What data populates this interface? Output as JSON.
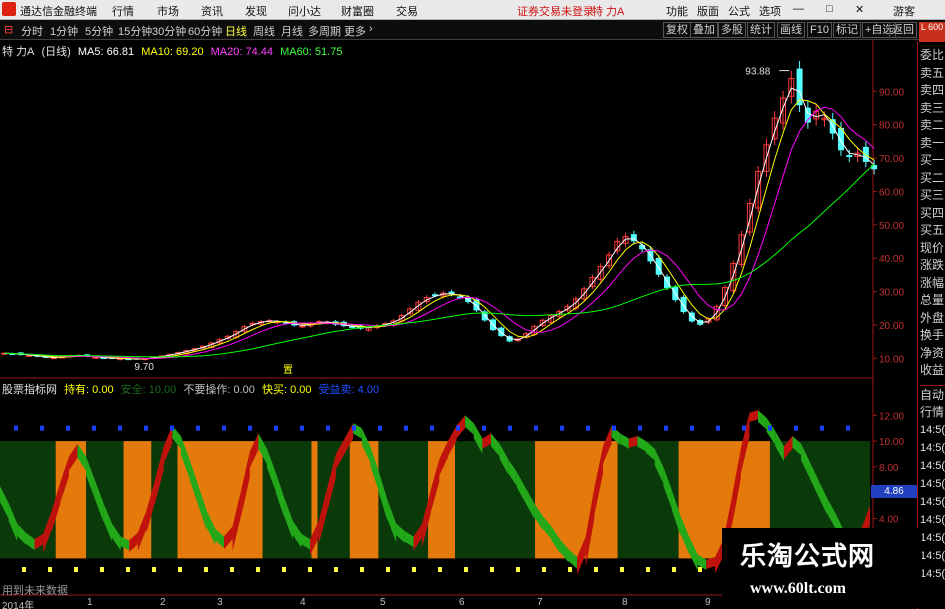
{
  "menubar": {
    "app_title": "通达信金融终端",
    "items": [
      "行情",
      "市场",
      "资讯",
      "发现",
      "问小达",
      "财富圈",
      "交易"
    ],
    "notice": "证券交易未登录",
    "stock_name": "特 力A",
    "right_items": [
      "功能",
      "版面",
      "公式",
      "选项"
    ],
    "user": "游客"
  },
  "toolbar": {
    "periods": [
      "分时",
      "1分钟",
      "5分钟",
      "15分钟",
      "30分钟",
      "60分钟",
      "日线",
      "周线",
      "月线",
      "多周期",
      "更多"
    ],
    "active_period": "日线",
    "right_buttons": [
      "复权",
      "叠加",
      "多股",
      "统计",
      "画线",
      "F10",
      "标记",
      "+自选",
      "返回"
    ]
  },
  "main_chart": {
    "name": "特 力A",
    "period": "(日线)",
    "ma5": "MA5: 66.81",
    "ma10": "MA10: 69.20",
    "ma20": "MA20: 74.44",
    "ma60": "MA60: 51.75",
    "high_label": "93.88",
    "low_label": "9.70",
    "marker_label": "置",
    "colors": {
      "ma5": "#ffffff",
      "ma10": "#ffff00",
      "ma20": "#ff00ff",
      "ma60": "#00ff00",
      "up": "#ff3c3c",
      "down": "#54ffff"
    }
  },
  "indicator": {
    "name": "股票指标网",
    "hold": "持有: 0.00",
    "safe": "安全: 10.00",
    "noop": "不要操作: 0.00",
    "buy": "快买: 0.00",
    "sell_label": "受益卖: 4.00",
    "value_badge": "4.86"
  },
  "chart_data": [
    {
      "type": "candlestick",
      "title": "特 力A (日线)",
      "ylim": [
        5,
        100
      ],
      "y_ticks": [
        "90.00",
        "80.00",
        "70.00",
        "60.00",
        "50.00",
        "40.00",
        "30.00",
        "20.00",
        "10.00"
      ],
      "x_ticks": [
        "2014年",
        "1",
        "2",
        "3",
        "4",
        "5",
        "6",
        "7",
        "8",
        "9"
      ],
      "ma_last": {
        "MA5": 66.81,
        "MA10": 69.2,
        "MA20": 74.44,
        "MA60": 51.75
      },
      "close_path": [
        11.5,
        11.4,
        11.1,
        10.9,
        10.6,
        10.3,
        10.2,
        10.4,
        10.8,
        10.9,
        10.6,
        10.3,
        10.1,
        10.0,
        9.9,
        9.8,
        9.8,
        9.9,
        10.3,
        10.7,
        11.2,
        11.7,
        12.3,
        12.9,
        13.6,
        14.6,
        15.6,
        16.6,
        18.0,
        19.5,
        20.5,
        21.0,
        21.3,
        21.0,
        20.6,
        20.0,
        19.7,
        20.4,
        21.0,
        20.8,
        20.2,
        19.8,
        19.5,
        19.0,
        19.3,
        19.8,
        20.4,
        21.2,
        22.8,
        24.8,
        26.8,
        28.2,
        29.0,
        29.5,
        29.3,
        28.4,
        27.0,
        24.5,
        21.5,
        18.6,
        16.8,
        15.2,
        15.8,
        17.4,
        19.6,
        21.4,
        22.8,
        24.0,
        25.6,
        27.8,
        30.8,
        34.2,
        37.5,
        41.0,
        45.0,
        46.5,
        45.2,
        42.8,
        39.2,
        35.2,
        31.2,
        27.6,
        24.0,
        21.2,
        20.2,
        21.8,
        25.5,
        31.2,
        38.4,
        47.0,
        56.4,
        66.0,
        74.0,
        82.0,
        88.0,
        93.88,
        86.0,
        80.8,
        84.0,
        82.0,
        77.5,
        72.5,
        70.5,
        71.5,
        69.0,
        66.81
      ],
      "up_color": "#ff3c3c",
      "down_color": "#54ffff"
    },
    {
      "type": "area",
      "title": "股票指标网",
      "ylim": [
        0,
        13.5
      ],
      "y_ticks": [
        "12.00",
        "10.00",
        "8.00",
        "6.00",
        "4.00"
      ],
      "zones": [
        {
          "state": "hold",
          "from": 0,
          "to": 0.064
        },
        {
          "state": "safe",
          "from": 0.064,
          "to": 0.099
        },
        {
          "state": "hold",
          "from": 0.099,
          "to": 0.142
        },
        {
          "state": "safe",
          "from": 0.142,
          "to": 0.174
        },
        {
          "state": "hold",
          "from": 0.174,
          "to": 0.204
        },
        {
          "state": "safe",
          "from": 0.204,
          "to": 0.302
        },
        {
          "state": "hold",
          "from": 0.302,
          "to": 0.358
        },
        {
          "state": "safe",
          "from": 0.358,
          "to": 0.365
        },
        {
          "state": "hold",
          "from": 0.365,
          "to": 0.402
        },
        {
          "state": "safe",
          "from": 0.402,
          "to": 0.435
        },
        {
          "state": "hold",
          "from": 0.435,
          "to": 0.492
        },
        {
          "state": "safe",
          "from": 0.492,
          "to": 0.523
        },
        {
          "state": "hold",
          "from": 0.523,
          "to": 0.615
        },
        {
          "state": "safe",
          "from": 0.615,
          "to": 0.71
        },
        {
          "state": "hold",
          "from": 0.71,
          "to": 0.78
        },
        {
          "state": "safe",
          "from": 0.78,
          "to": 0.885
        },
        {
          "state": "hold",
          "from": 0.885,
          "to": 1
        }
      ],
      "wave": [
        6.5,
        5.2,
        3.6,
        2.9,
        2.4,
        2.8,
        4.6,
        6.8,
        8.8,
        9.8,
        8.8,
        7.0,
        5.2,
        3.6,
        2.6,
        2.3,
        2.9,
        4.6,
        7.0,
        9.6,
        11.2,
        10.4,
        8.6,
        6.6,
        4.6,
        3.2,
        2.6,
        3.4,
        6.2,
        9.2,
        10.6,
        9.4,
        7.6,
        5.6,
        3.8,
        2.8,
        2.4,
        3.8,
        6.4,
        9.0,
        10.2,
        11.4,
        11.0,
        9.6,
        7.6,
        5.4,
        3.6,
        3.0,
        2.6,
        3.6,
        6.2,
        8.6,
        10.0,
        11.2,
        12.0,
        11.4,
        10.2,
        10.6,
        9.8,
        8.6,
        7.6,
        6.4,
        5.2,
        4.2,
        3.4,
        2.4,
        1.6,
        1.0,
        2.6,
        6.4,
        9.6,
        11.2,
        10.6,
        10.2,
        10.4,
        10.0,
        9.4,
        8.0,
        6.2,
        4.2,
        2.6,
        1.2,
        0.8,
        1.0,
        2.4,
        5.8,
        9.4,
        12.2,
        12.4,
        11.8,
        10.8,
        9.6,
        10.4,
        9.8,
        8.4,
        7.0,
        5.6,
        4.4,
        3.0,
        2.2,
        3.2,
        5.0
      ],
      "colors": {
        "hold": "#0a3a0a",
        "safe": "#e57a0c",
        "rise": "#c0120c",
        "fall": "#22a818"
      }
    }
  ],
  "side_panel": {
    "labels": [
      "委比",
      "卖五",
      "卖四",
      "卖三",
      "卖二",
      "卖一",
      "买一",
      "买二",
      "买三",
      "买四",
      "买五",
      "现价",
      "涨跌",
      "涨幅",
      "总量",
      "外盘",
      "换手",
      "净资",
      "收益"
    ],
    "section2": [
      "自动",
      "行情"
    ],
    "times": [
      "14:5(",
      "14:5(",
      "14:5(",
      "14:5(",
      "14:5(",
      "14:5(",
      "14:5(",
      "14:5(",
      "14:5("
    ],
    "logo": "L 600"
  },
  "footer": {
    "future_note": "用到未来数据"
  },
  "watermark": {
    "title": "乐淘公式网",
    "url": "www.60lt.com"
  }
}
